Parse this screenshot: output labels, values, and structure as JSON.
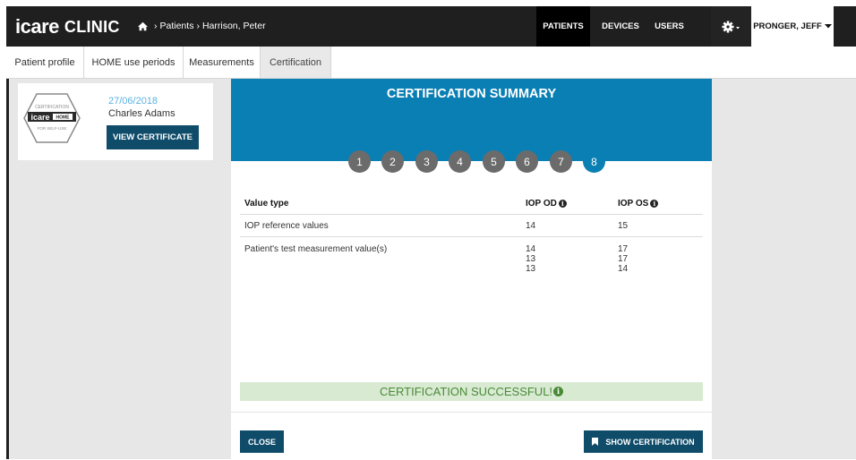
{
  "app": {
    "brand": "icare",
    "brand_suffix": "CLINIC"
  },
  "breadcrumb": {
    "home_icon": "home-icon",
    "items": [
      "Patients",
      "Harrison, Peter"
    ],
    "separator": "›"
  },
  "topnav": {
    "patients": "PATIENTS",
    "devices": "DEVICES",
    "users": "USERS",
    "settings_icon": "gear-icon",
    "user_menu": "PRONGER, JEFF"
  },
  "tabs": [
    "Patient profile",
    "HOME use periods",
    "Measurements",
    "Certification"
  ],
  "active_tab": "Certification",
  "cert_card": {
    "badge_icon": "certification-badge",
    "date": "27/06/2018",
    "name": "Charles Adams",
    "view_button": "VIEW CERTIFICATE"
  },
  "modal": {
    "title": "CERTIFICATION SUMMARY",
    "steps": [
      "1",
      "2",
      "3",
      "4",
      "5",
      "6",
      "7",
      "8"
    ],
    "active_step": "8",
    "table": {
      "headers": [
        "Value type",
        "IOP OD",
        "IOP OS"
      ],
      "rows": [
        {
          "type": "IOP reference values",
          "od": [
            "14"
          ],
          "os": [
            "15"
          ]
        },
        {
          "type": "Patient's test measurement value(s)",
          "od": [
            "14",
            "13",
            "13"
          ],
          "os": [
            "17",
            "17",
            "14"
          ]
        }
      ]
    },
    "status": "CERTIFICATION SUCCESSFUL!",
    "close_button": "CLOSE",
    "show_button": "SHOW CERTIFICATION"
  },
  "colors": {
    "topbar": "#1f1f1f",
    "header_blue": "#0a7fb3",
    "button_dark": "#0f4c6a",
    "success_bg": "#d9ead3",
    "success_text": "#4a8a37",
    "step_inactive": "#6b6b6b",
    "date_blue": "#5bb1dd"
  }
}
